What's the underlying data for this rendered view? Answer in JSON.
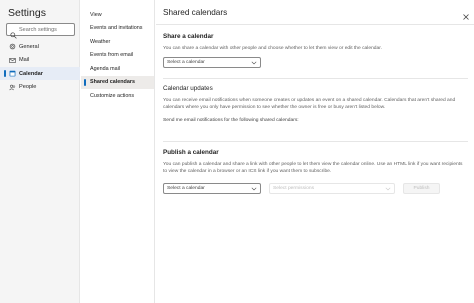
{
  "sidebar": {
    "title": "Settings",
    "search_placeholder": "Search settings",
    "items": [
      {
        "label": "General",
        "icon": "gear-icon"
      },
      {
        "label": "Mail",
        "icon": "mail-icon"
      },
      {
        "label": "Calendar",
        "icon": "calendar-icon",
        "active": true
      },
      {
        "label": "People",
        "icon": "people-icon"
      }
    ]
  },
  "subnav": {
    "items": [
      {
        "label": "View"
      },
      {
        "label": "Events and invitations"
      },
      {
        "label": "Weather"
      },
      {
        "label": "Events from email"
      },
      {
        "label": "Agenda mail"
      },
      {
        "label": "Shared calendars",
        "active": true
      },
      {
        "label": "Customize actions"
      }
    ]
  },
  "main": {
    "title": "Shared calendars",
    "share": {
      "heading": "Share a calendar",
      "description": "You can share a calendar with other people and choose whether to let them view or edit the calendar.",
      "dropdown_value": "Select a calendar"
    },
    "updates": {
      "heading": "Calendar updates",
      "description": "You can receive email notifications when someone creates or updates an event on a shared calendar. Calendars that aren't shared and calendars where you only have permission to see whether the owner is free or busy aren't listed below.",
      "send_me": "Send me email notifications for the following shared calendars:"
    },
    "publish": {
      "heading": "Publish a calendar",
      "description": "You can publish a calendar and share a link with other people to let them view the calendar online. Use an HTML link if you want recipients to view the calendar in a browser or an ICS link if you want them to subscribe.",
      "calendar_dropdown": "Select a calendar",
      "permissions_dropdown": "Select permissions",
      "publish_label": "Publish"
    }
  },
  "colors": {
    "accent": "#0f6cbd",
    "active_bg": "#e6ecf6",
    "sidebar_bg": "#f5f5f5"
  }
}
